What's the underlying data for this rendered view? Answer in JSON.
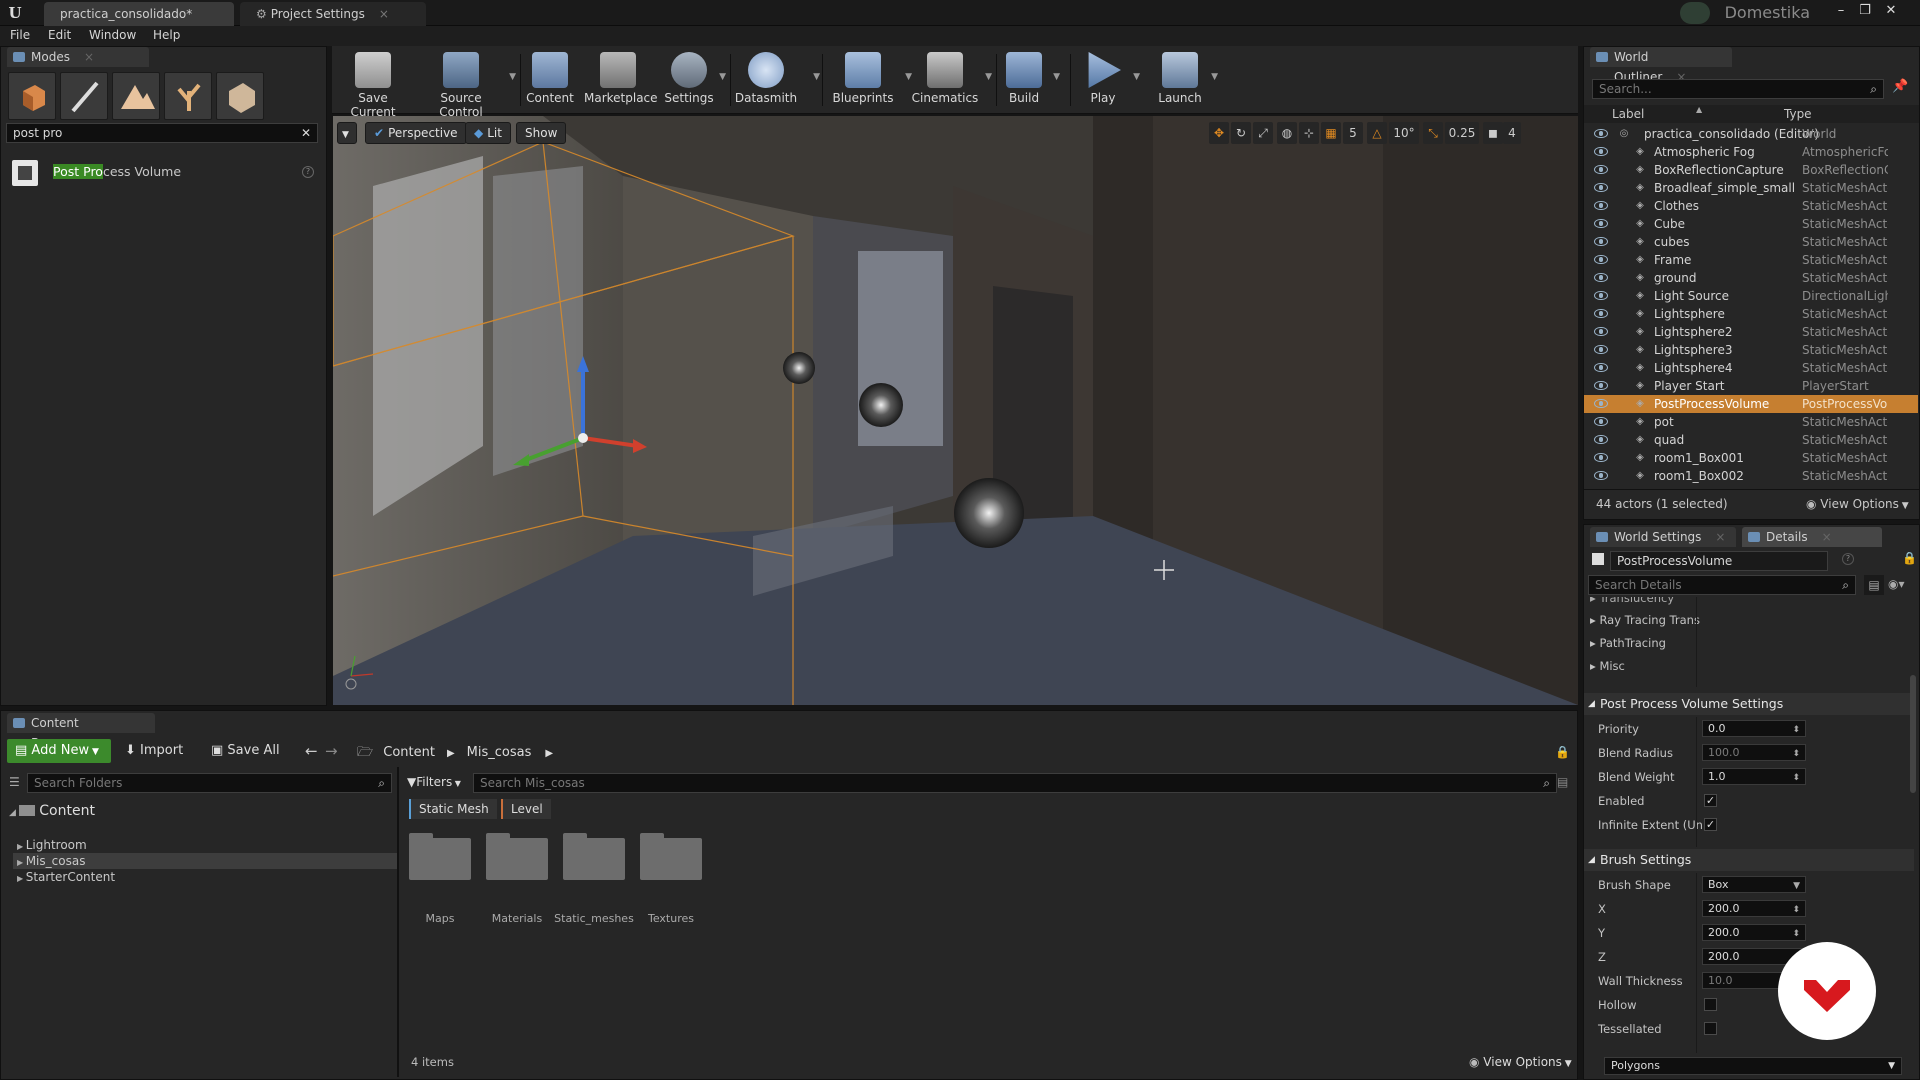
{
  "window": {
    "tabs": [
      {
        "label": "practica_consolidado*"
      },
      {
        "label": "Project Settings"
      }
    ],
    "brand": "Domestika"
  },
  "menu": [
    "File",
    "Edit",
    "Window",
    "Help"
  ],
  "modes": {
    "tab": "Modes",
    "search_value": "post pro",
    "result": {
      "highlight": "Post Pro",
      "rest": "cess Volume"
    }
  },
  "toolbar": [
    {
      "label": "Save Current",
      "icon": "save-icon"
    },
    {
      "label": "Source Control",
      "icon": "source-control-icon"
    },
    {
      "label": "Content",
      "icon": "content-icon"
    },
    {
      "label": "Marketplace",
      "icon": "marketplace-icon"
    },
    {
      "label": "Settings",
      "icon": "settings-icon"
    },
    {
      "label": "Datasmith",
      "icon": "datasmith-icon"
    },
    {
      "label": "Blueprints",
      "icon": "blueprints-icon"
    },
    {
      "label": "Cinematics",
      "icon": "cinematics-icon"
    },
    {
      "label": "Build",
      "icon": "build-icon"
    },
    {
      "label": "Play",
      "icon": "play-icon"
    },
    {
      "label": "Launch",
      "icon": "launch-icon"
    }
  ],
  "viewport": {
    "perspective": "Perspective",
    "lit": "Lit",
    "show": "Show",
    "grid_snap": "5",
    "rot_snap": "10°",
    "scale_snap": "0.25",
    "cam_speed": "4"
  },
  "outliner": {
    "tab": "World Outliner",
    "search_placeholder": "Search...",
    "col_label": "Label",
    "col_type": "Type",
    "root": {
      "label": "practica_consolidado (Editor)",
      "type": "World"
    },
    "rows": [
      {
        "label": "Atmospheric Fog",
        "type": "AtmosphericFog"
      },
      {
        "label": "BoxReflectionCapture",
        "type": "BoxReflectionC"
      },
      {
        "label": "Broadleaf_simple_small",
        "type": "StaticMeshActo"
      },
      {
        "label": "Clothes",
        "type": "StaticMeshActo"
      },
      {
        "label": "Cube",
        "type": "StaticMeshActo"
      },
      {
        "label": "cubes",
        "type": "StaticMeshActo"
      },
      {
        "label": "Frame",
        "type": "StaticMeshActo"
      },
      {
        "label": "ground",
        "type": "StaticMeshActo"
      },
      {
        "label": "Light Source",
        "type": "DirectionalLigh"
      },
      {
        "label": "Lightsphere",
        "type": "StaticMeshActo"
      },
      {
        "label": "Lightsphere2",
        "type": "StaticMeshActo"
      },
      {
        "label": "Lightsphere3",
        "type": "StaticMeshActo"
      },
      {
        "label": "Lightsphere4",
        "type": "StaticMeshActo"
      },
      {
        "label": "Player Start",
        "type": "PlayerStart"
      },
      {
        "label": "PostProcessVolume",
        "type": "PostProcessVo",
        "selected": true
      },
      {
        "label": "pot",
        "type": "StaticMeshActo"
      },
      {
        "label": "quad",
        "type": "StaticMeshActo"
      },
      {
        "label": "room1_Box001",
        "type": "StaticMeshActo"
      },
      {
        "label": "room1_Box002",
        "type": "StaticMeshActo"
      }
    ],
    "footer": "44 actors (1 selected)",
    "view_options": "View Options"
  },
  "details": {
    "tabs": [
      "World Settings",
      "Details"
    ],
    "object_name": "PostProcessVolume",
    "search_placeholder": "Search Details",
    "categories": [
      "Translucency",
      "Ray Tracing Trans",
      "PathTracing",
      "Misc"
    ],
    "pp_section": "Post Process Volume Settings",
    "pp_props": [
      {
        "label": "Priority",
        "value": "0.0"
      },
      {
        "label": "Blend Radius",
        "value": "100.0",
        "dim": true
      },
      {
        "label": "Blend Weight",
        "value": "1.0"
      },
      {
        "label": "Enabled",
        "checked": true
      },
      {
        "label": "Infinite Extent (Unb",
        "checked": true
      }
    ],
    "brush_section": "Brush Settings",
    "brush_props": [
      {
        "label": "Brush Shape",
        "value": "Box",
        "dropdown": true
      },
      {
        "label": "X",
        "value": "200.0"
      },
      {
        "label": "Y",
        "value": "200.0"
      },
      {
        "label": "Z",
        "value": "200.0"
      },
      {
        "label": "Wall Thickness",
        "value": "10.0",
        "dim": true
      },
      {
        "label": "Hollow",
        "checked": false
      },
      {
        "label": "Tessellated",
        "checked": false
      }
    ],
    "bottom_select": "Polygons"
  },
  "content_browser": {
    "tab": "Content Browser",
    "add_new": "Add New",
    "import": "Import",
    "save_all": "Save All",
    "path": [
      "Content",
      "Mis_cosas"
    ],
    "search_folders": "Search Folders",
    "filters": "Filters",
    "search_assets": "Search Mis_cosas",
    "filter_chips": [
      "Static Mesh",
      "Level"
    ],
    "tree_root": "Content",
    "tree": [
      {
        "label": "Lightroom"
      },
      {
        "label": "Mis_cosas",
        "selected": true
      },
      {
        "label": "StarterContent"
      }
    ],
    "folders": [
      "Maps",
      "Materials",
      "Static_meshes",
      "Textures"
    ],
    "count": "4 items",
    "view_options": "View Options"
  },
  "colors": {
    "accent_orange": "#e08a21",
    "selected_row": "#c67f30",
    "add_new_green": "#3c8a2c",
    "folder_red": "#c0392b"
  }
}
